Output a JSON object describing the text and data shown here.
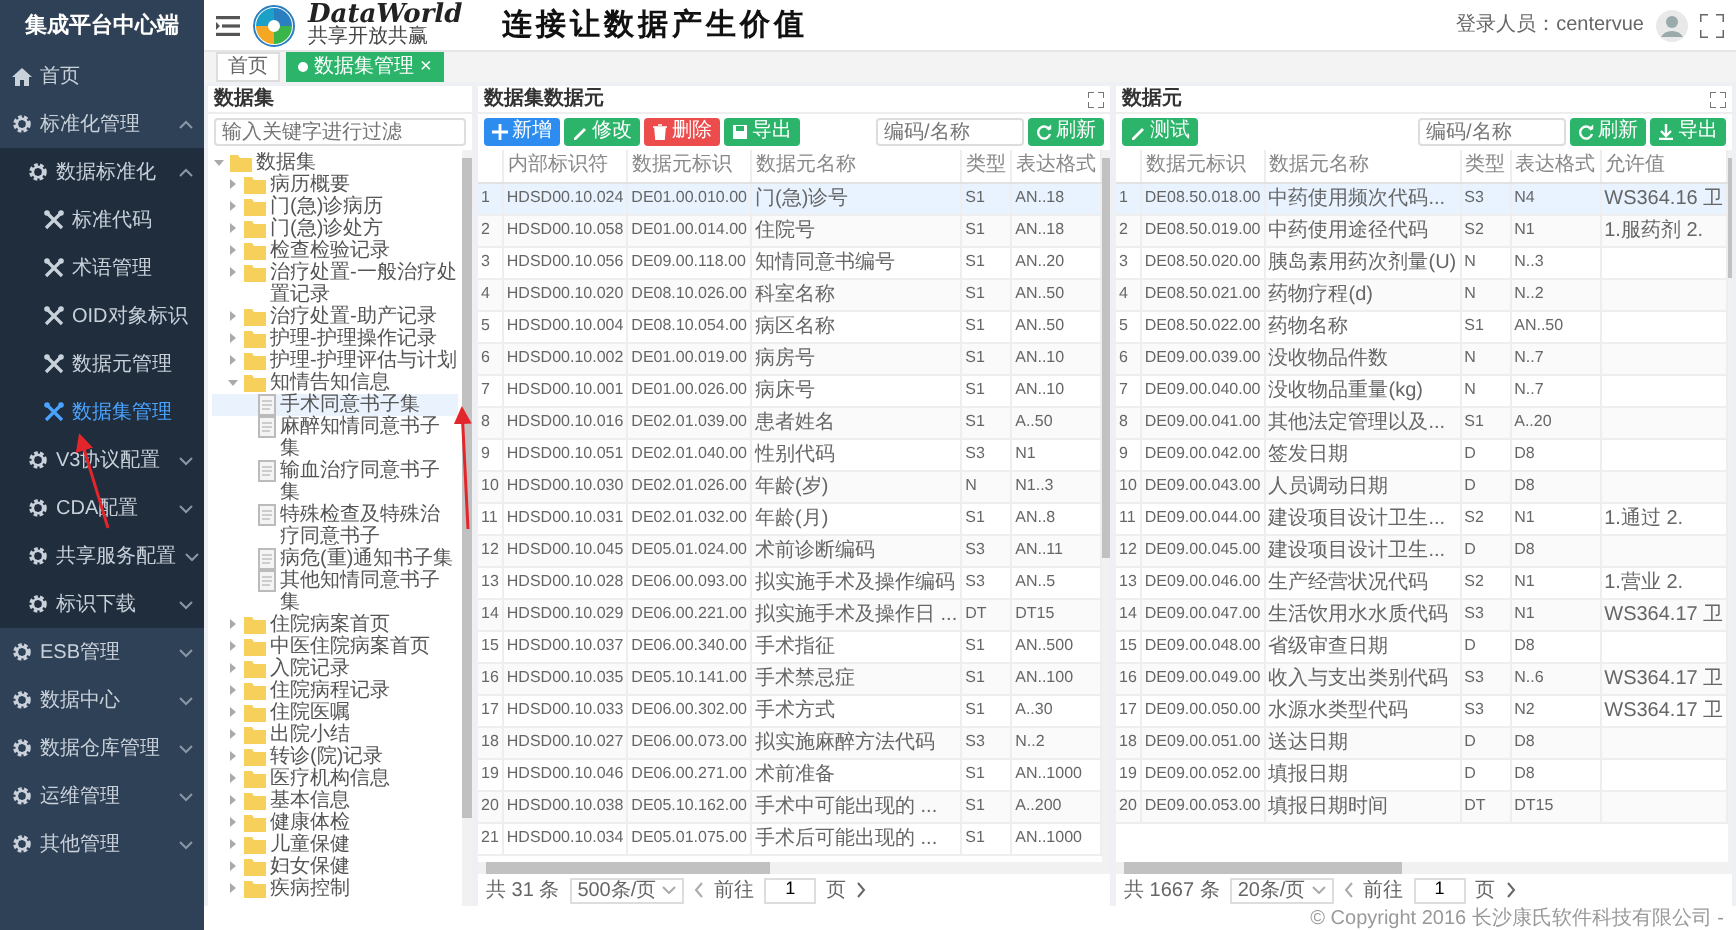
{
  "sidebar": {
    "title": "集成平台中心端",
    "items": [
      {
        "label": "首页",
        "kind": "home"
      },
      {
        "label": "标准化管理",
        "kind": "menu",
        "expanded": true,
        "children": [
          {
            "label": "数据标准化",
            "kind": "menu",
            "expanded": true,
            "children": [
              {
                "label": "标准代码",
                "kind": "page",
                "selected": false
              },
              {
                "label": "术语管理",
                "kind": "page",
                "selected": false
              },
              {
                "label": "OID对象标识",
                "kind": "page",
                "selected": false
              },
              {
                "label": "数据元管理",
                "kind": "page",
                "selected": false
              },
              {
                "label": "数据集管理",
                "kind": "page",
                "selected": true
              }
            ]
          },
          {
            "label": "V3协议配置",
            "kind": "menu",
            "expanded": false
          },
          {
            "label": "CDA配置",
            "kind": "menu",
            "expanded": false
          },
          {
            "label": "共享服务配置",
            "kind": "menu",
            "expanded": false
          },
          {
            "label": "标识下载",
            "kind": "menu",
            "expanded": false
          }
        ]
      },
      {
        "label": "ESB管理",
        "kind": "menu",
        "expanded": false
      },
      {
        "label": "数据中心",
        "kind": "menu",
        "expanded": false
      },
      {
        "label": "数据仓库管理",
        "kind": "menu",
        "expanded": false
      },
      {
        "label": "运维管理",
        "kind": "menu",
        "expanded": false
      },
      {
        "label": "其他管理",
        "kind": "menu",
        "expanded": false
      }
    ]
  },
  "header": {
    "logo": {
      "name": "DataWorld",
      "tagline": "共享开放共赢"
    },
    "slogan": "连接让数据产生价值",
    "user": "登录人员：centervue"
  },
  "tabs": [
    {
      "label": "首页",
      "selected": false
    },
    {
      "label": "数据集管理",
      "selected": true,
      "close": "×"
    }
  ],
  "tree": {
    "title": "数据集",
    "filter": {
      "placeholder": "输入关键字进行过滤"
    },
    "nodes": [
      {
        "label": "数据集",
        "kind": "folder",
        "expanded": true,
        "children": [
          {
            "label": "病历概要",
            "kind": "folder",
            "expanded": false
          },
          {
            "label": "门(急)诊病历",
            "kind": "folder",
            "expanded": false
          },
          {
            "label": "门(急)诊处方",
            "kind": "folder",
            "expanded": false
          },
          {
            "label": "检查检验记录",
            "kind": "folder",
            "expanded": false
          },
          {
            "label": "治疗处置-一般治疗处置记录",
            "kind": "folder",
            "expanded": false
          },
          {
            "label": "治疗处置-助产记录",
            "kind": "folder",
            "expanded": false
          },
          {
            "label": "护理-护理操作记录",
            "kind": "folder",
            "expanded": false
          },
          {
            "label": "护理-护理评估与计划",
            "kind": "folder",
            "expanded": false
          },
          {
            "label": "知情告知信息",
            "kind": "folder",
            "expanded": true,
            "children": [
              {
                "label": "手术同意书子集",
                "kind": "doc",
                "selected": true
              },
              {
                "label": "麻醉知情同意书子集",
                "kind": "doc",
                "selected": false
              },
              {
                "label": "输血治疗同意书子集",
                "kind": "doc",
                "selected": false
              },
              {
                "label": "特殊检查及特殊治疗同意书子",
                "kind": "doc",
                "selected": false
              },
              {
                "label": "病危(重)通知书子集",
                "kind": "doc",
                "selected": false
              },
              {
                "label": "其他知情同意书子集",
                "kind": "doc",
                "selected": false
              }
            ]
          },
          {
            "label": "住院病案首页",
            "kind": "folder",
            "expanded": false
          },
          {
            "label": "中医住院病案首页",
            "kind": "folder",
            "expanded": false
          },
          {
            "label": "入院记录",
            "kind": "folder",
            "expanded": false
          },
          {
            "label": "住院病程记录",
            "kind": "folder",
            "expanded": false
          },
          {
            "label": "住院医嘱",
            "kind": "folder",
            "expanded": false
          },
          {
            "label": "出院小结",
            "kind": "folder",
            "expanded": false
          },
          {
            "label": "转诊(院)记录",
            "kind": "folder",
            "expanded": false
          },
          {
            "label": "医疗机构信息",
            "kind": "folder",
            "expanded": false
          },
          {
            "label": "基本信息",
            "kind": "folder",
            "expanded": false
          },
          {
            "label": "健康体检",
            "kind": "folder",
            "expanded": false
          },
          {
            "label": "儿童保健",
            "kind": "folder",
            "expanded": false
          },
          {
            "label": "妇女保健",
            "kind": "folder",
            "expanded": false
          },
          {
            "label": "疾病控制",
            "kind": "folder",
            "expanded": false
          }
        ]
      }
    ]
  },
  "panels": [
    {
      "title": "数据集数据元",
      "buttons": [
        {
          "label": "新增",
          "kind": "add"
        },
        {
          "label": "修改",
          "kind": "edit"
        },
        {
          "label": "删除",
          "kind": "delete"
        },
        {
          "label": "导出",
          "kind": "export"
        }
      ],
      "search": {
        "placeholder": "编码/名称"
      },
      "right_buttons": [
        {
          "label": "刷新",
          "kind": "refresh"
        }
      ],
      "table": {
        "columns": [
          "",
          "内部标识符",
          "数据元标识",
          "数据元名称",
          "类型",
          "表达格式"
        ],
        "rows": [
          {
            "selected": true,
            "cells": [
              "1",
              "HDSD00.10.024",
              "DE01.00.010.00",
              "门(急)诊号",
              "S1",
              "AN..18"
            ]
          },
          {
            "selected": false,
            "cells": [
              "2",
              "HDSD00.10.058",
              "DE01.00.014.00",
              "住院号",
              "S1",
              "AN..18"
            ]
          },
          {
            "selected": false,
            "cells": [
              "3",
              "HDSD00.10.056",
              "DE09.00.118.00",
              "知情同意书编号",
              "S1",
              "AN..20"
            ]
          },
          {
            "selected": false,
            "cells": [
              "4",
              "HDSD00.10.020",
              "DE08.10.026.00",
              "科室名称",
              "S1",
              "AN..50"
            ]
          },
          {
            "selected": false,
            "cells": [
              "5",
              "HDSD00.10.004",
              "DE08.10.054.00",
              "病区名称",
              "S1",
              "AN..50"
            ]
          },
          {
            "selected": false,
            "cells": [
              "6",
              "HDSD00.10.002",
              "DE01.00.019.00",
              "病房号",
              "S1",
              "AN..10"
            ]
          },
          {
            "selected": false,
            "cells": [
              "7",
              "HDSD00.10.001",
              "DE01.00.026.00",
              "病床号",
              "S1",
              "AN..10"
            ]
          },
          {
            "selected": false,
            "cells": [
              "8",
              "HDSD00.10.016",
              "DE02.01.039.00",
              "患者姓名",
              "S1",
              "A..50"
            ]
          },
          {
            "selected": false,
            "cells": [
              "9",
              "HDSD00.10.051",
              "DE02.01.040.00",
              "性别代码",
              "S3",
              "N1"
            ]
          },
          {
            "selected": false,
            "cells": [
              "10",
              "HDSD00.10.030",
              "DE02.01.026.00",
              "年龄(岁)",
              "N",
              "N1..3"
            ]
          },
          {
            "selected": false,
            "cells": [
              "11",
              "HDSD00.10.031",
              "DE02.01.032.00",
              "年龄(月)",
              "S1",
              "AN..8"
            ]
          },
          {
            "selected": false,
            "cells": [
              "12",
              "HDSD00.10.045",
              "DE05.01.024.00",
              "术前诊断编码",
              "S3",
              "AN..11"
            ]
          },
          {
            "selected": false,
            "cells": [
              "13",
              "HDSD00.10.028",
              "DE06.00.093.00",
              "拟实施手术及操作编码",
              "S3",
              "AN..5"
            ]
          },
          {
            "selected": false,
            "cells": [
              "14",
              "HDSD00.10.029",
              "DE06.00.221.00",
              "拟实施手术及操作日 ...",
              "DT",
              "DT15"
            ]
          },
          {
            "selected": false,
            "cells": [
              "15",
              "HDSD00.10.037",
              "DE06.00.340.00",
              "手术指征",
              "S1",
              "AN..500"
            ]
          },
          {
            "selected": false,
            "cells": [
              "16",
              "HDSD00.10.035",
              "DE05.10.141.00",
              "手术禁忌症",
              "S1",
              "AN..100"
            ]
          },
          {
            "selected": false,
            "cells": [
              "17",
              "HDSD00.10.033",
              "DE06.00.302.00",
              "手术方式",
              "S1",
              "A..30"
            ]
          },
          {
            "selected": false,
            "cells": [
              "18",
              "HDSD00.10.027",
              "DE06.00.073.00",
              "拟实施麻醉方法代码",
              "S3",
              "N..2"
            ]
          },
          {
            "selected": false,
            "cells": [
              "19",
              "HDSD00.10.046",
              "DE06.00.271.00",
              "术前准备",
              "S1",
              "AN..1000"
            ]
          },
          {
            "selected": false,
            "cells": [
              "20",
              "HDSD00.10.038",
              "DE05.10.162.00",
              "手术中可能出现的 ...",
              "S1",
              "A..200"
            ]
          },
          {
            "selected": false,
            "cells": [
              "21",
              "HDSD00.10.034",
              "DE05.01.075.00",
              "手术后可能出现的 ...",
              "S1",
              "AN..1000"
            ]
          }
        ]
      },
      "pagination": {
        "total": "共 31 条",
        "page_size": "500条/页",
        "goto": "前往",
        "page": "1",
        "unit": "页"
      }
    },
    {
      "title": "数据元",
      "buttons": [
        {
          "label": "测试",
          "kind": "test"
        }
      ],
      "search": {
        "placeholder": "编码/名称"
      },
      "right_buttons": [
        {
          "label": "刷新",
          "kind": "refresh"
        },
        {
          "label": "导出",
          "kind": "download"
        }
      ],
      "table": {
        "columns": [
          "",
          "数据元标识",
          "数据元名称",
          "类型",
          "表达格式",
          "允许值"
        ],
        "rows": [
          {
            "selected": true,
            "cells": [
              "1",
              "DE08.50.018.00",
              "中药使用频次代码...",
              "S3",
              "N4",
              "WS364.16 卫"
            ]
          },
          {
            "selected": false,
            "cells": [
              "2",
              "DE08.50.019.00",
              "中药使用途径代码",
              "S2",
              "N1",
              "1.服药剂 2."
            ]
          },
          {
            "selected": false,
            "cells": [
              "3",
              "DE08.50.020.00",
              "胰岛素用药次剂量(U)",
              "N",
              "N..3",
              ""
            ]
          },
          {
            "selected": false,
            "cells": [
              "4",
              "DE08.50.021.00",
              "药物疗程(d)",
              "N",
              "N..2",
              ""
            ]
          },
          {
            "selected": false,
            "cells": [
              "5",
              "DE08.50.022.00",
              "药物名称",
              "S1",
              "AN..50",
              ""
            ]
          },
          {
            "selected": false,
            "cells": [
              "6",
              "DE09.00.039.00",
              "没收物品件数",
              "N",
              "N..7",
              ""
            ]
          },
          {
            "selected": false,
            "cells": [
              "7",
              "DE09.00.040.00",
              "没收物品重量(kg)",
              "N",
              "N..7",
              ""
            ]
          },
          {
            "selected": false,
            "cells": [
              "8",
              "DE09.00.041.00",
              "其他法定管理以及...",
              "S1",
              "A..20",
              ""
            ]
          },
          {
            "selected": false,
            "cells": [
              "9",
              "DE09.00.042.00",
              "签发日期",
              "D",
              "D8",
              ""
            ]
          },
          {
            "selected": false,
            "cells": [
              "10",
              "DE09.00.043.00",
              "人员调动日期",
              "D",
              "D8",
              ""
            ]
          },
          {
            "selected": false,
            "cells": [
              "11",
              "DE09.00.044.00",
              "建设项目设计卫生...",
              "S2",
              "N1",
              "1.通过 2."
            ]
          },
          {
            "selected": false,
            "cells": [
              "12",
              "DE09.00.045.00",
              "建设项目设计卫生...",
              "D",
              "D8",
              ""
            ]
          },
          {
            "selected": false,
            "cells": [
              "13",
              "DE09.00.046.00",
              "生产经营状况代码",
              "S2",
              "N1",
              "1.营业 2."
            ]
          },
          {
            "selected": false,
            "cells": [
              "14",
              "DE09.00.047.00",
              "生活饮用水水质代码",
              "S3",
              "N1",
              "WS364.17 卫"
            ]
          },
          {
            "selected": false,
            "cells": [
              "15",
              "DE09.00.048.00",
              "省级审查日期",
              "D",
              "D8",
              ""
            ]
          },
          {
            "selected": false,
            "cells": [
              "16",
              "DE09.00.049.00",
              "收入与支出类别代码",
              "S3",
              "N..6",
              "WS364.17 卫"
            ]
          },
          {
            "selected": false,
            "cells": [
              "17",
              "DE09.00.050.00",
              "水源水类型代码",
              "S3",
              "N2",
              "WS364.17 卫"
            ]
          },
          {
            "selected": false,
            "cells": [
              "18",
              "DE09.00.051.00",
              "送达日期",
              "D",
              "D8",
              ""
            ]
          },
          {
            "selected": false,
            "cells": [
              "19",
              "DE09.00.052.00",
              "填报日期",
              "D",
              "D8",
              ""
            ]
          },
          {
            "selected": false,
            "cells": [
              "20",
              "DE09.00.053.00",
              "填报日期时间",
              "DT",
              "DT15",
              ""
            ]
          }
        ]
      },
      "pagination": {
        "total": "共 1667 条",
        "page_size": "20条/页",
        "goto": "前往",
        "page": "1",
        "unit": "页"
      }
    }
  ],
  "footer": "© Copyright 2016 长沙康氏软件科技有限公司 -",
  "annotations": [
    {
      "kind": "arrow"
    },
    {
      "kind": "arrow"
    }
  ]
}
